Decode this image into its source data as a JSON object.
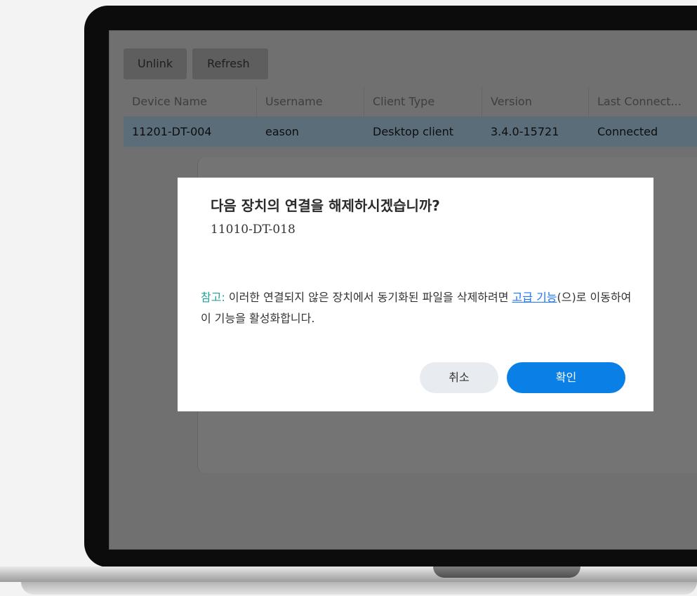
{
  "toolbar": {
    "unlink_label": "Unlink",
    "refresh_label": "Refresh"
  },
  "table": {
    "columns": [
      "Device Name",
      "Username",
      "Client Type",
      "Version",
      "Last Connect..."
    ],
    "rows": [
      [
        "11201-DT-004",
        "eason",
        "Desktop client",
        "3.4.0-15721",
        "Connected"
      ]
    ]
  },
  "dialog": {
    "title": "다음 장치의 연결을 해제하시겠습니까?",
    "device_name": "11010-DT-018",
    "note_label": "참고:",
    "note_text_before": " 이러한 연결되지 않은 장치에서 동기화된 파일을 삭제하려면 ",
    "note_link": "고급 기능",
    "note_text_after": "(으)로 이동하여 이 기능을 활성화합니다.",
    "cancel_label": "취소",
    "confirm_label": "확인"
  },
  "colors": {
    "confirm_button": "#0a7fe6",
    "note_label": "#21a39a",
    "link": "#1a75ff"
  }
}
